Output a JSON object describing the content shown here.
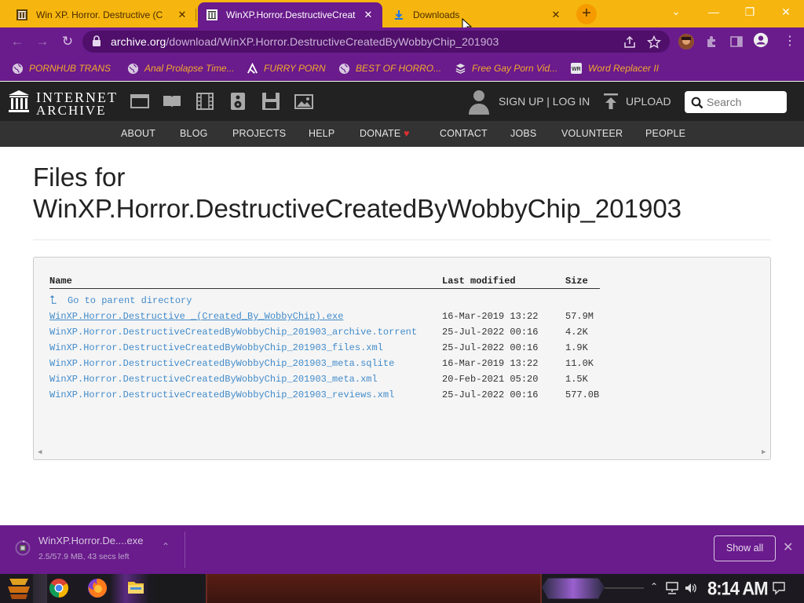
{
  "browser": {
    "tabs": [
      {
        "title": "Win XP. Horror. Destructive (C",
        "active": false
      },
      {
        "title": "WinXP.Horror.DestructiveCreat",
        "active": true
      },
      {
        "title": "Downloads",
        "active": false
      }
    ],
    "new_tab_label": "+",
    "window_controls": {
      "dropdown": "⌄",
      "minimize": "—",
      "restore": "❐",
      "close": "✕"
    },
    "url": {
      "domain": "archive.org",
      "path": "/download/WinXP.Horror.DestructiveCreatedByWobbyChip_201903"
    },
    "bookmarks": [
      {
        "label": "PORNHUB TRANS",
        "icon": "globe-icon"
      },
      {
        "label": "Anal Prolapse Time...",
        "icon": "globe-icon"
      },
      {
        "label": "FURRY PORN",
        "icon": "lambda-icon"
      },
      {
        "label": "BEST OF HORRO...",
        "icon": "globe-icon"
      },
      {
        "label": "Free Gay Porn Vid...",
        "icon": "stack-icon"
      },
      {
        "label": "Word Replacer II",
        "icon": "wr-icon"
      }
    ],
    "colors": {
      "frame": "#6a1b8c",
      "tabstrip": "#f6b60f",
      "bookmark_text": "#f2a92c"
    }
  },
  "ia": {
    "logo_line1": "INTERNET",
    "logo_line2": "ARCHIVE",
    "media_icons": [
      "web-icon",
      "texts-icon",
      "video-icon",
      "audio-icon",
      "software-icon",
      "images-icon"
    ],
    "sign_in": "SIGN UP | LOG IN",
    "upload": "UPLOAD",
    "search_placeholder": "Search",
    "nav": [
      "ABOUT",
      "BLOG",
      "PROJECTS",
      "HELP",
      "DONATE",
      "CONTACT",
      "JOBS",
      "VOLUNTEER",
      "PEOPLE"
    ],
    "donate_heart": "♥"
  },
  "page": {
    "title_line1": "Files for",
    "title_line2": "WinXP.Horror.DestructiveCreatedByWobbyChip_201903",
    "table": {
      "headers": {
        "name": "Name",
        "modified": "Last modified",
        "size": "Size"
      },
      "parent_icon": "⮤",
      "parent": "Go to parent directory",
      "rows": [
        {
          "name": "WinXP.Horror.Destructive _(Created_By_WobbyChip).exe",
          "modified": "16-Mar-2019 13:22",
          "size": "57.9M"
        },
        {
          "name": "WinXP.Horror.DestructiveCreatedByWobbyChip_201903_archive.torrent",
          "modified": "25-Jul-2022 00:16",
          "size": "4.2K"
        },
        {
          "name": "WinXP.Horror.DestructiveCreatedByWobbyChip_201903_files.xml",
          "modified": "25-Jul-2022 00:16",
          "size": "1.9K"
        },
        {
          "name": "WinXP.Horror.DestructiveCreatedByWobbyChip_201903_meta.sqlite",
          "modified": "16-Mar-2019 13:22",
          "size": "11.0K"
        },
        {
          "name": "WinXP.Horror.DestructiveCreatedByWobbyChip_201903_meta.xml",
          "modified": "20-Feb-2021 05:20",
          "size": "1.5K"
        },
        {
          "name": "WinXP.Horror.DestructiveCreatedByWobbyChip_201903_reviews.xml",
          "modified": "25-Jul-2022 00:16",
          "size": "577.0B"
        }
      ]
    }
  },
  "download_shelf": {
    "file": "WinXP.Horror.De....exe",
    "status": "2.5/57.9 MB, 43 secs left",
    "progress_fraction": 0.043,
    "show_all": "Show all",
    "chevron": "⌃",
    "close": "✕"
  },
  "taskbar": {
    "clock": "8:14 AM",
    "apps": [
      "start-icon",
      "chrome-icon",
      "firefox-icon",
      "app-icon",
      "folder-icon"
    ],
    "tray": [
      "chevron-up-icon",
      "network-icon",
      "volume-icon",
      "notification-icon"
    ]
  }
}
